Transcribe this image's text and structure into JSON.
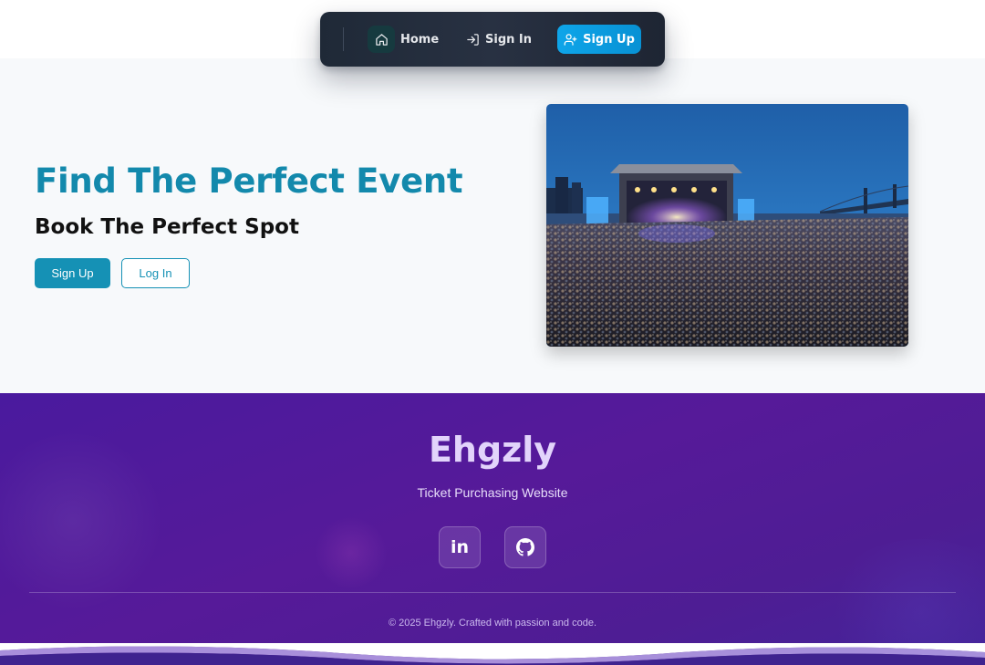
{
  "nav": {
    "home_label": "Home",
    "signin_label": "Sign In",
    "signup_label": "Sign Up"
  },
  "hero": {
    "title": "Find The Perfect Event",
    "subtitle": "Book The Perfect Spot",
    "signup_button": "Sign Up",
    "login_button": "Log In",
    "image_alt": "Outdoor concert crowd at dusk near a bridge"
  },
  "footer": {
    "brand": "Ehgzly",
    "tagline": "Ticket Purchasing Website",
    "social": [
      {
        "name": "linkedin",
        "label": "in"
      },
      {
        "name": "github",
        "label": ""
      }
    ],
    "copyright": "© 2025 Ehgzly. Crafted with passion and code."
  },
  "colors": {
    "accent": "#1389ac",
    "nav_bg": "#1f2937",
    "nav_cta": "#0ea5e9",
    "footer_bg": "#561a99"
  }
}
